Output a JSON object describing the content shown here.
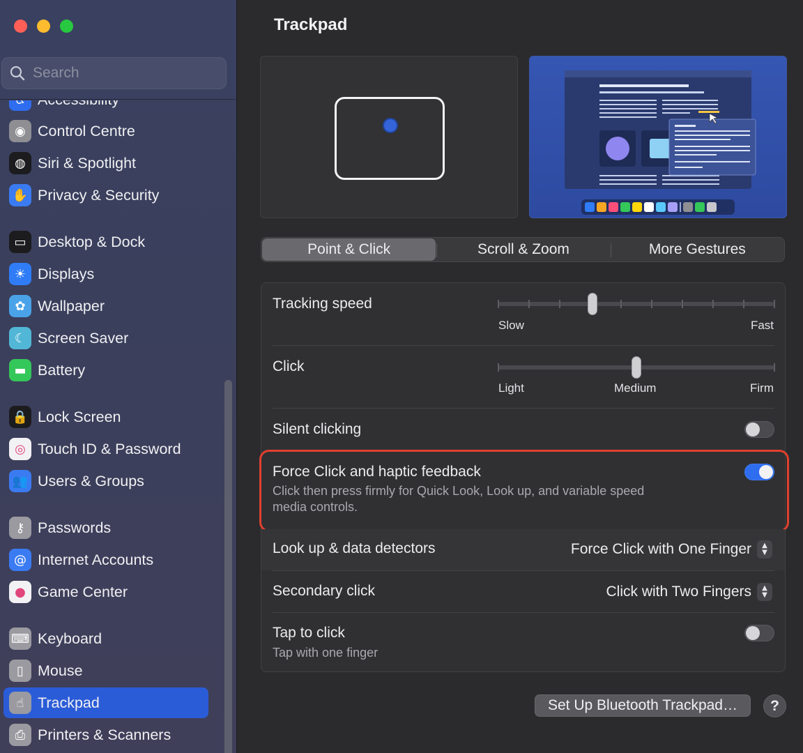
{
  "window": {
    "title": "Trackpad"
  },
  "search": {
    "placeholder": "Search"
  },
  "sidebar": {
    "items": [
      {
        "label": "Accessibility",
        "icon": "accessibility-icon",
        "color": "#2f6df0"
      },
      {
        "label": "Control Centre",
        "icon": "control-centre-icon",
        "color": "#8e8e93"
      },
      {
        "label": "Siri & Spotlight",
        "icon": "siri-icon",
        "color": "#1c1c1e"
      },
      {
        "label": "Privacy & Security",
        "icon": "hand-icon",
        "color": "#3a7bf2"
      },
      {
        "label": "Desktop & Dock",
        "icon": "dock-icon",
        "color": "#1c1c1e"
      },
      {
        "label": "Displays",
        "icon": "sun-icon",
        "color": "#2f7cf6"
      },
      {
        "label": "Wallpaper",
        "icon": "flower-icon",
        "color": "#4aa3e8"
      },
      {
        "label": "Screen Saver",
        "icon": "screen-saver-icon",
        "color": "#52b7d6"
      },
      {
        "label": "Battery",
        "icon": "battery-icon",
        "color": "#34c759"
      },
      {
        "label": "Lock Screen",
        "icon": "lock-icon",
        "color": "#1c1c1e"
      },
      {
        "label": "Touch ID & Password",
        "icon": "fingerprint-icon",
        "color": "#f2f2f4"
      },
      {
        "label": "Users & Groups",
        "icon": "users-icon",
        "color": "#3a7bf2"
      },
      {
        "label": "Passwords",
        "icon": "key-icon",
        "color": "#9a9aa0"
      },
      {
        "label": "Internet Accounts",
        "icon": "at-icon",
        "color": "#3a7bf2"
      },
      {
        "label": "Game Center",
        "icon": "game-center-icon",
        "color": "#f2f2f4"
      },
      {
        "label": "Keyboard",
        "icon": "keyboard-icon",
        "color": "#9a9aa0"
      },
      {
        "label": "Mouse",
        "icon": "mouse-icon",
        "color": "#9a9aa0"
      },
      {
        "label": "Trackpad",
        "icon": "trackpad-icon",
        "color": "#9a9aa0",
        "selected": true
      },
      {
        "label": "Printers & Scanners",
        "icon": "printer-icon",
        "color": "#9a9aa0"
      }
    ]
  },
  "tabs": [
    {
      "label": "Point & Click",
      "active": true
    },
    {
      "label": "Scroll & Zoom",
      "active": false
    },
    {
      "label": "More Gestures",
      "active": false
    }
  ],
  "settings": {
    "tracking_speed": {
      "label": "Tracking speed",
      "min_label": "Slow",
      "max_label": "Fast",
      "level": 0.34
    },
    "click": {
      "label": "Click",
      "min_label": "Light",
      "mid_label": "Medium",
      "max_label": "Firm",
      "level": 0.5
    },
    "silent_clicking": {
      "label": "Silent clicking",
      "enabled": false
    },
    "force_click": {
      "label": "Force Click and haptic feedback",
      "description_line1": "Click then press firmly for Quick Look, Look up, and variable speed",
      "description_line2": "media controls.",
      "enabled": true
    },
    "look_up": {
      "label": "Look up & data detectors",
      "value": "Force Click with One Finger"
    },
    "secondary_click": {
      "label": "Secondary click",
      "value": "Click with Two Fingers"
    },
    "tap_to_click": {
      "label": "Tap to click",
      "description": "Tap with one finger",
      "enabled": false
    }
  },
  "buttons": {
    "bluetooth": "Set Up Bluetooth Trackpad…",
    "help": "?"
  },
  "colors": {
    "accent": "#2f6df0",
    "highlight": "#e0402e"
  }
}
